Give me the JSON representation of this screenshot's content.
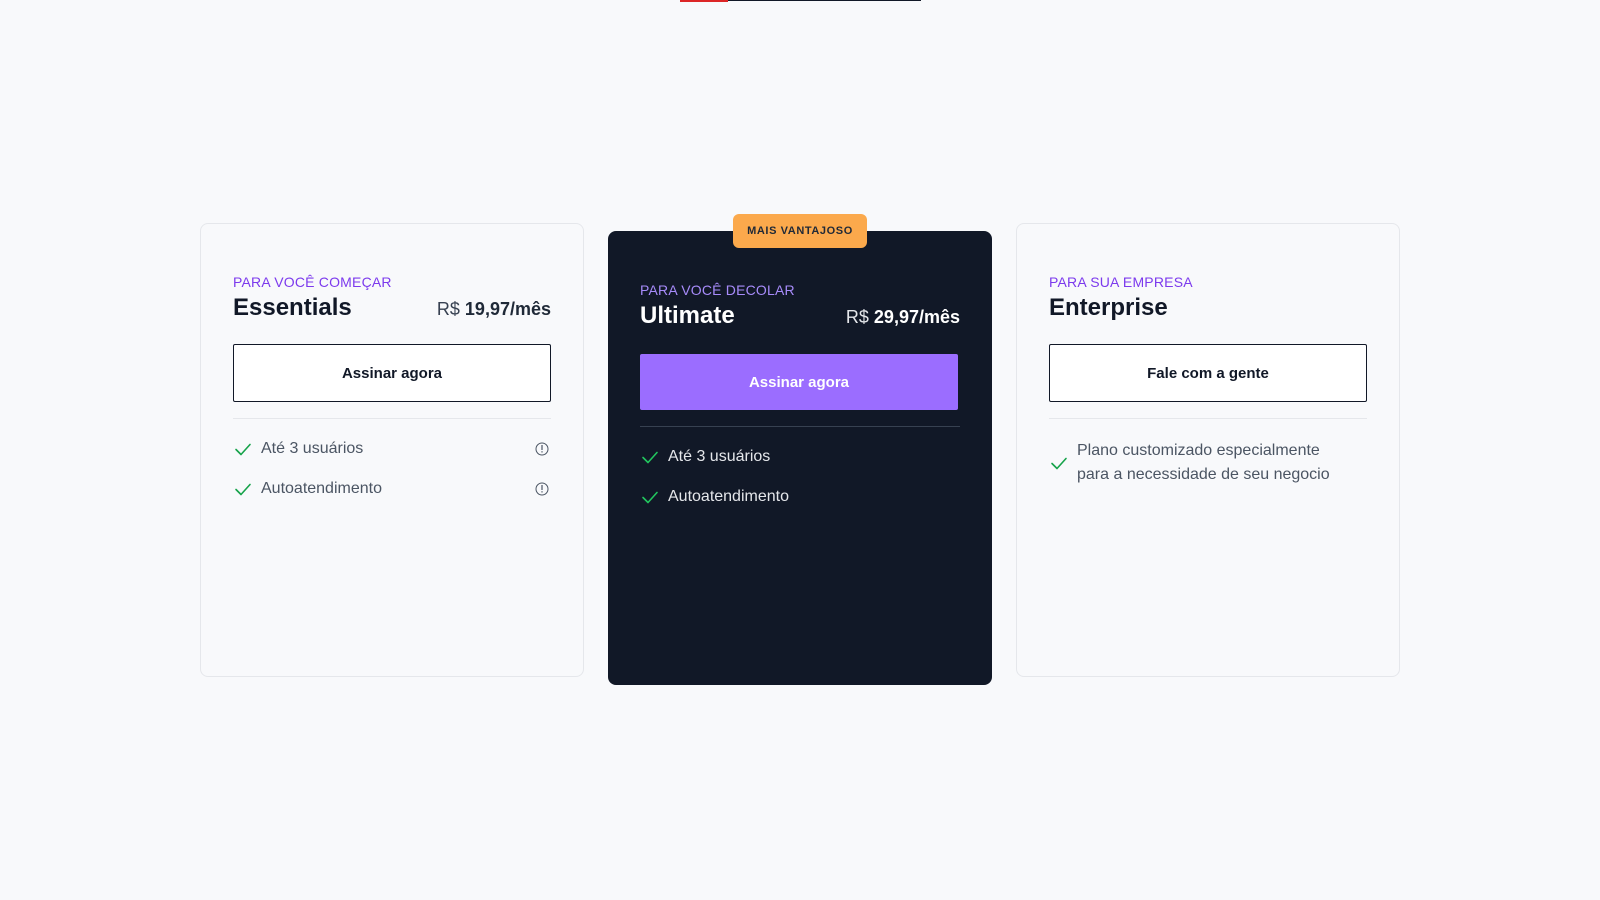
{
  "badge": "MAIS VANTAJOSO",
  "plans": [
    {
      "eyebrow": "PARA VOCÊ COMEÇAR",
      "name": "Essentials",
      "currency": "R$",
      "amount": "19,97/mês",
      "cta": "Assinar agora",
      "features": [
        "Até 3 usuários",
        "Autoatendimento"
      ]
    },
    {
      "eyebrow": "PARA VOCÊ DECOLAR",
      "name": "Ultimate",
      "currency": "R$",
      "amount": "29,97/mês",
      "cta": "Assinar agora",
      "features": [
        "Até 3 usuários",
        "Autoatendimento"
      ]
    },
    {
      "eyebrow": "PARA SUA EMPRESA",
      "name": "Enterprise",
      "cta": "Fale com a gente",
      "features": [
        "Plano customizado especialmente para a necessidade de seu negocio"
      ]
    }
  ],
  "icons": {
    "check": "check-icon",
    "info": "info-icon"
  },
  "colors": {
    "accent_purple": "#9b6dff",
    "badge_orange": "#fba94c",
    "dark_card": "#111827",
    "check_green": "#16a34a",
    "active_tab": "#dc2626"
  }
}
